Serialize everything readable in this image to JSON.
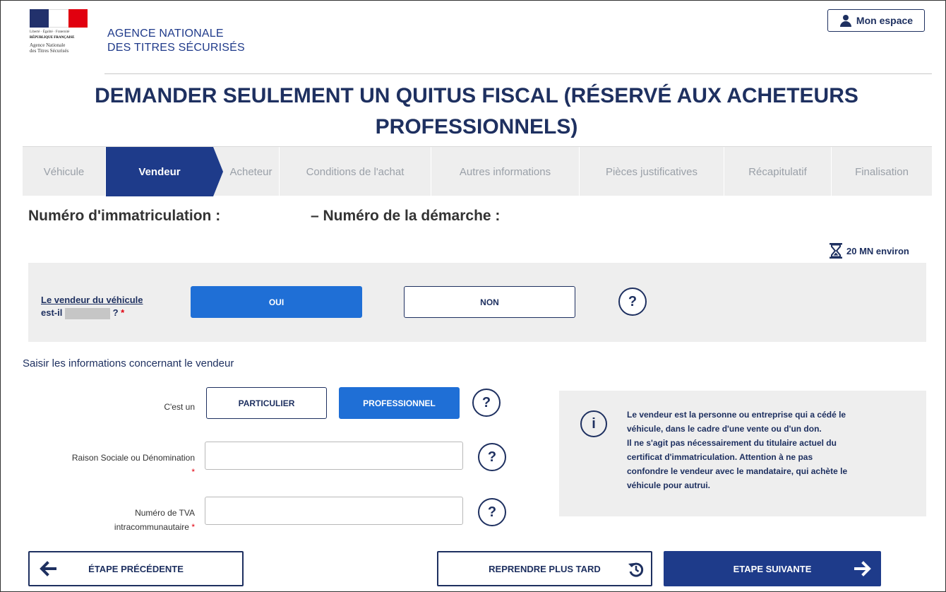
{
  "header": {
    "logo": {
      "motto": "Liberté · Égalité · Fraternité",
      "republic": "RÉPUBLIQUE FRANÇAISE",
      "agency_line1": "Agence Nationale",
      "agency_line2": "des Titres Sécurisés"
    },
    "agency_line1": "AGENCE NATIONALE",
    "agency_line2": "DES TITRES SÉCURISÉS",
    "account_button": "Mon espace"
  },
  "page_title_line1": "DEMANDER SEULEMENT UN QUITUS FISCAL (RÉSERVÉ AUX ACHETEURS",
  "page_title_line2": "PROFESSIONNELS)",
  "stepper": {
    "steps": [
      {
        "label": "Véhicule",
        "active": false
      },
      {
        "label": "Vendeur",
        "active": true
      },
      {
        "label": "Acheteur",
        "active": false
      },
      {
        "label": "Conditions de l'achat",
        "active": false
      },
      {
        "label": "Autres informations",
        "active": false
      },
      {
        "label": "Pièces justificatives",
        "active": false
      },
      {
        "label": "Récapitulatif",
        "active": false
      },
      {
        "label": "Finalisation",
        "active": false
      }
    ]
  },
  "registration_label": "Numéro d'immatriculation :",
  "procedure_label": "– Numéro de la démarche :",
  "duration": "20 MN environ",
  "seller_question": {
    "line1": "Le vendeur du véhicule",
    "line2_prefix": "est-il",
    "line2_suffix": "?",
    "required_mark": "*",
    "yes_label": "OUI",
    "no_label": "NON",
    "selected": "OUI",
    "help_symbol": "?"
  },
  "section_title": "Saisir les informations concernant le vendeur",
  "form": {
    "type_label": "C'est un",
    "type_options": [
      "PARTICULIER",
      "PROFESSIONNEL"
    ],
    "type_selected": "PROFESSIONNEL",
    "company_label": "Raison Sociale ou Dénomination",
    "company_value": "",
    "vat_label_line1": "Numéro de TVA",
    "vat_label_line2": "intracommunautaire",
    "vat_value": "",
    "required_mark": "*",
    "help_symbol": "?"
  },
  "info_box": {
    "icon": "i",
    "lines": [
      "Le vendeur est la personne ou entreprise qui a cédé le",
      "véhicule, dans le cadre d'une vente ou d'un don.",
      "Il ne s'agit pas nécessairement du titulaire actuel du",
      "certificat d'immatriculation. Attention à ne pas",
      "confondre le vendeur avec le mandataire, qui achète le",
      "véhicule pour autrui."
    ]
  },
  "nav": {
    "previous": "ÉTAPE PRÉCÉDENTE",
    "later": "REPRENDRE PLUS TARD",
    "next": "ETAPE SUIVANTE"
  },
  "colors": {
    "navy": "#1e3b8a",
    "primary_blue": "#1f6fd6",
    "panel_grey": "#eeeeee",
    "required_red": "#e1000f"
  }
}
